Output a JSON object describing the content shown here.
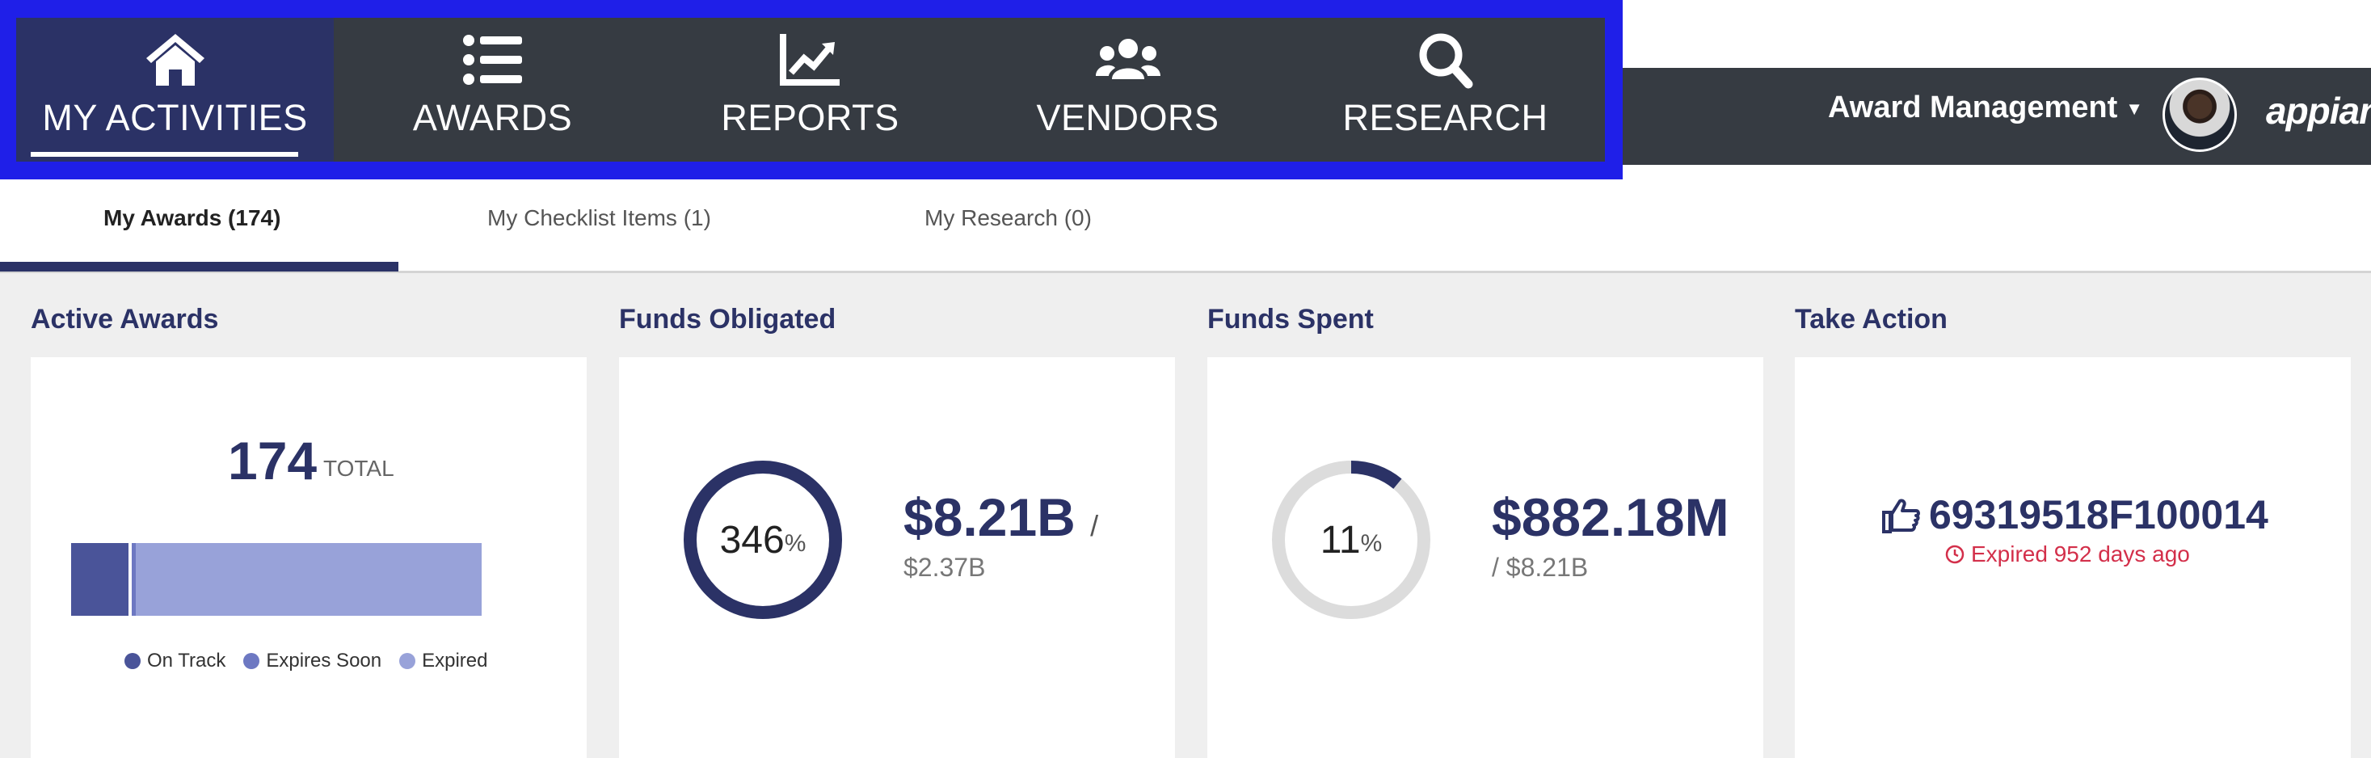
{
  "nav": {
    "items": [
      {
        "label": "MY ACTIVITIES",
        "icon": "home-icon",
        "active": true
      },
      {
        "label": "AWARDS",
        "icon": "list-icon"
      },
      {
        "label": "REPORTS",
        "icon": "chart-line-icon"
      },
      {
        "label": "VENDORS",
        "icon": "users-icon"
      },
      {
        "label": "RESEARCH",
        "icon": "search-icon"
      }
    ]
  },
  "header": {
    "app_name": "Award Management",
    "brand": "appian"
  },
  "tabs": [
    {
      "label": "My Awards (174)",
      "active": true
    },
    {
      "label": "My Checklist Items (1)"
    },
    {
      "label": "My Research (0)"
    }
  ],
  "active_awards": {
    "title": "Active Awards",
    "total": "174",
    "total_label": "TOTAL",
    "legend": [
      "On Track",
      "Expires Soon",
      "Expired"
    ],
    "colors": {
      "on_track": "#4a5499",
      "expires_soon": "#6d78c2",
      "expired": "#98a2d9"
    },
    "share": {
      "on_track": 0.14,
      "expires_soon": 0.01,
      "expired": 0.85
    }
  },
  "funds_obligated": {
    "title": "Funds Obligated",
    "percent": "346",
    "percent_sign": "%",
    "amount": "$8.21B",
    "slash": "/",
    "of_amount": "$2.37B",
    "ring_fraction": 1.0
  },
  "funds_spent": {
    "title": "Funds Spent",
    "percent": "11",
    "percent_sign": "%",
    "amount": "$882.18M",
    "of_amount": "/ $8.21B",
    "ring_fraction": 0.11
  },
  "take_action": {
    "title": "Take Action",
    "award_id": "69319518F100014",
    "status": "Expired 952 days ago"
  }
}
